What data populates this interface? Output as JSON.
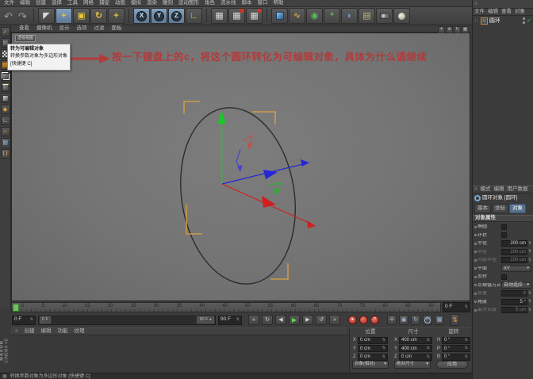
{
  "menubar": {
    "items": [
      "文件",
      "编辑",
      "创建",
      "选择",
      "工具",
      "网格",
      "捕捉",
      "动画",
      "模拟",
      "渲染",
      "雕刻",
      "运动图形",
      "角色",
      "流水线",
      "脚本",
      "窗口",
      "帮助"
    ]
  },
  "toolbar": {
    "axis_x": "X",
    "axis_y": "Y",
    "axis_z": "Z",
    "icons": [
      "undo",
      "redo",
      "live-selection",
      "move",
      "scale",
      "rotate",
      "last-tool",
      "lock-x",
      "lock-y",
      "lock-z",
      "coordinate-system",
      "render-view",
      "render-to-picture-viewer",
      "render-settings",
      "primitive-cube",
      "spline-pen",
      "subdivision-surface",
      "deformer",
      "nurbs-generator",
      "floor",
      "camera",
      "light"
    ]
  },
  "sidebar": {
    "icons": [
      "convert-to-editable",
      "model-mode",
      "texture-mode",
      "workplane-mode",
      "points-mode",
      "edges-mode",
      "polygons-mode",
      "texture-axis-mode",
      "enable-axis",
      "snap-magnet",
      "snap-settings",
      "viewport-solo"
    ]
  },
  "viewport": {
    "menu": [
      "查看",
      "摄像机",
      "显示",
      "选项",
      "过滤",
      "面板"
    ],
    "view_label": "透视视图",
    "corner_icons": [
      "pan-view",
      "zoom-view",
      "rotate-view",
      "toggle-views"
    ]
  },
  "tooltip": {
    "title": "转为可编辑对象",
    "line2": "转换参数对象为多边形对象",
    "shortcut": "[快捷键 C]"
  },
  "annotation": {
    "text": "按一下键盘上的c，将这个圆环转化为可编辑对象，具体为什么请继续",
    "color": "#b23b3b"
  },
  "timeline": {
    "ticks": [
      "0",
      "5",
      "10",
      "15",
      "20",
      "25",
      "30",
      "35",
      "40",
      "45",
      "50",
      "55",
      "60",
      "65",
      "70",
      "75",
      "80",
      "85",
      "90"
    ],
    "current_frame": "0 F",
    "start_frame": "0 F",
    "end_frame": "90 F",
    "range_start": "0 F",
    "range_end": "90 F"
  },
  "transport": {
    "buttons": [
      "go-to-start",
      "loop-mode",
      "previous-frame",
      "play-forward",
      "next-frame",
      "play-mode",
      "go-to-end",
      "record-keyframe",
      "autokey",
      "keyframe-selection",
      "key-position",
      "key-scale",
      "key-rotation",
      "key-parameter",
      "key-pla",
      "record-options"
    ]
  },
  "material_manager": {
    "menu": [
      "创建",
      "编辑",
      "功能",
      "纹理"
    ]
  },
  "coordinate_manager": {
    "columns": [
      {
        "header": "位置",
        "rows": [
          {
            "axis": "X",
            "value": "0 cm"
          },
          {
            "axis": "Y",
            "value": "0 cm"
          },
          {
            "axis": "Z",
            "value": "0 cm"
          }
        ]
      },
      {
        "header": "尺寸",
        "rows": [
          {
            "axis": "X",
            "value": "400 cm"
          },
          {
            "axis": "Y",
            "value": "400 cm"
          },
          {
            "axis": "Z",
            "value": "0 cm"
          }
        ]
      },
      {
        "header": "旋转",
        "rows": [
          {
            "axis": "H",
            "value": "0 °"
          },
          {
            "axis": "P",
            "value": "0 °"
          },
          {
            "axis": "B",
            "value": "0 °"
          }
        ]
      }
    ],
    "mode_dropdown": "对象(相对)",
    "size_dropdown": "绝对尺寸",
    "apply_button": "应用"
  },
  "object_manager": {
    "menu": [
      "文件",
      "编辑",
      "查看",
      "对象"
    ],
    "items": [
      {
        "label": "圆环"
      }
    ]
  },
  "attribute_manager": {
    "menu": [
      "模式",
      "编辑",
      "用户数据"
    ],
    "title": "圆环对象 [圆环]",
    "tabs": [
      {
        "label": "基本"
      },
      {
        "label": "坐标"
      },
      {
        "label": "对象"
      }
    ],
    "active_tab": "对象",
    "section": "对象属性",
    "rows": [
      {
        "label": "椭圆",
        "type": "checkbox",
        "checked": false
      },
      {
        "label": "环状",
        "type": "checkbox",
        "checked": false
      },
      {
        "label": "半径",
        "value": "200 cm"
      },
      {
        "label": "半径",
        "value": "200 cm",
        "disabled": true
      },
      {
        "label": "内部半径",
        "value": "100 cm",
        "disabled": true
      },
      {
        "label": "平面",
        "value": "XY",
        "type": "dropdown"
      },
      {
        "label": "反转",
        "type": "checkbox",
        "checked": false
      },
      {
        "label": "点插值方式",
        "value": "自动适应",
        "type": "dropdown"
      },
      {
        "label": "数量",
        "value": "8",
        "disabled": true
      },
      {
        "label": "角度",
        "value": "5 °"
      },
      {
        "label": "最大长度",
        "value": "5 cm",
        "disabled": true
      }
    ]
  },
  "status_bar": {
    "text": "转换参数对象为多边形对象 [快捷键 C]"
  },
  "brand": {
    "line1": "MAXON",
    "line2": "CINEMA 4D"
  },
  "scene": {
    "object": "圆环",
    "gizmo_axes": [
      "x-red",
      "y-green",
      "z-blue"
    ],
    "selection_bracket_color": "#dda23f"
  }
}
